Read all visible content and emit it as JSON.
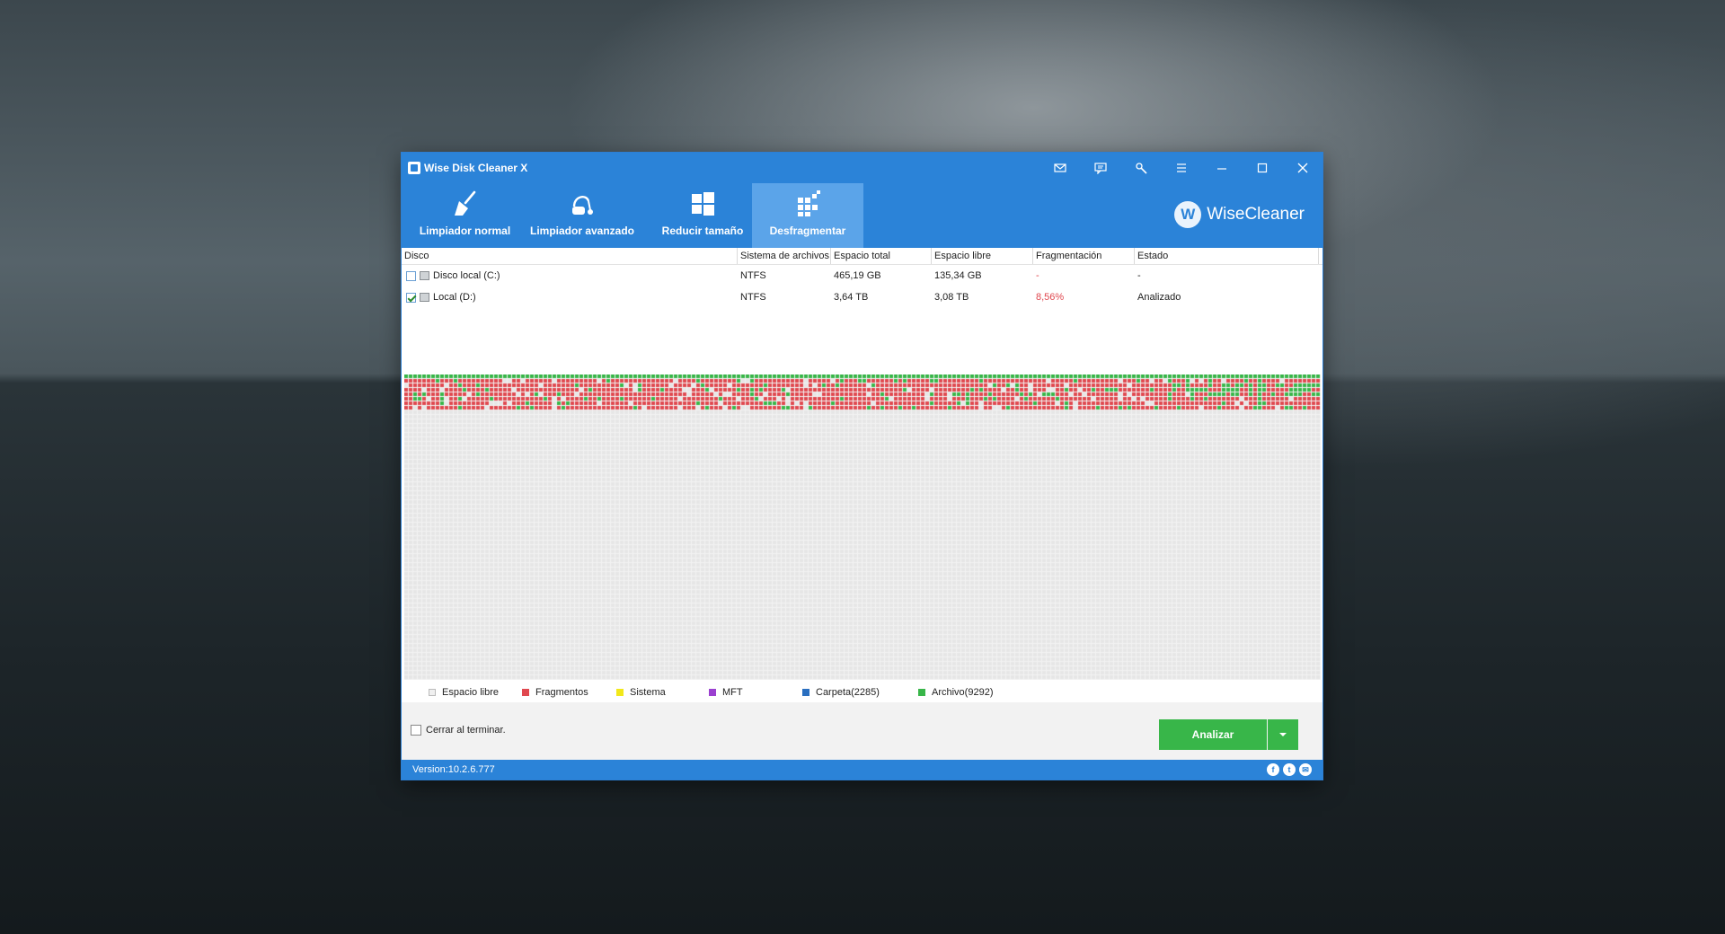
{
  "window": {
    "title": "Wise Disk Cleaner X",
    "controls": [
      "mail-icon",
      "feedback-icon",
      "tools-icon",
      "menu-icon",
      "minimize-icon",
      "maximize-icon",
      "close-icon"
    ]
  },
  "tabs": [
    {
      "label": "Limpiador normal",
      "icon": "broom-icon",
      "active": false
    },
    {
      "label": "Limpiador avanzado",
      "icon": "vacuum-icon",
      "active": false
    },
    {
      "label": "Reducir tamaño",
      "icon": "windows-icon",
      "active": false
    },
    {
      "label": "Desfragmentar",
      "icon": "defrag-icon",
      "active": true
    }
  ],
  "brand": {
    "logo_letter": "W",
    "name": "WiseCleaner"
  },
  "table": {
    "headers": [
      "Disco",
      "Sistema de archivos",
      "Espacio total",
      "Espacio libre",
      "Fragmentación",
      "Estado"
    ],
    "rows": [
      {
        "checked": false,
        "disk": "Disco local (C:)",
        "fs": "NTFS",
        "total": "465,19 GB",
        "free": "135,34 GB",
        "frag": "-",
        "state": "-"
      },
      {
        "checked": true,
        "disk": "Local (D:)",
        "fs": "NTFS",
        "total": "3,64 TB",
        "free": "3,08 TB",
        "frag": "8,56%",
        "state": "Analizado"
      }
    ]
  },
  "legend": [
    {
      "label": "Espacio libre",
      "color": "#f0f0f0"
    },
    {
      "label": "Fragmentos",
      "color": "#e0484f"
    },
    {
      "label": "Sistema",
      "color": "#f2e81a"
    },
    {
      "label": "MFT",
      "color": "#9b40d0"
    },
    {
      "label": "Carpeta(2285)",
      "color": "#2a6fc0"
    },
    {
      "label": "Archivo(9292)",
      "color": "#38b649"
    }
  ],
  "colors": {
    "accent": "#2b83d8",
    "tab_active": "#5ba4e9",
    "success": "#38b649",
    "fragment": "#e0484f",
    "free_block": "#e6e6e6"
  },
  "footer": {
    "close_on_finish": "Cerrar al terminar.",
    "analyze": "Analizar"
  },
  "status": {
    "version": "Version:10.2.6.777",
    "social": [
      "f",
      "t",
      "✉"
    ]
  }
}
